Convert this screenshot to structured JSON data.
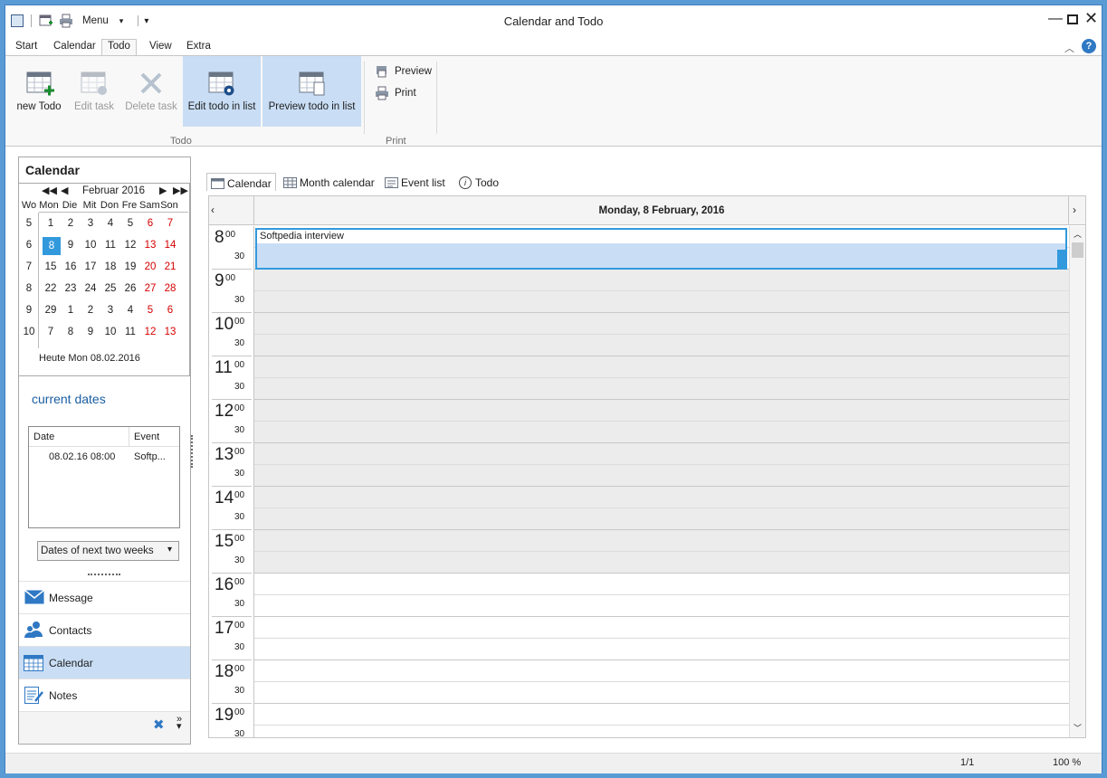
{
  "window": {
    "title": "Calendar and Todo"
  },
  "qat": {
    "menu_label": "Menu"
  },
  "ribbon_tabs": [
    "Start",
    "Calendar",
    "Todo",
    "View",
    "Extra"
  ],
  "ribbon": {
    "new_todo": "new Todo",
    "edit_task": "Edit task",
    "delete_task": "Delete task",
    "edit_todo_in_list": "Edit todo in list",
    "preview_todo_in_list": "Preview todo in list",
    "group_todo": "Todo",
    "preview": "Preview",
    "print": "Print",
    "group_print": "Print"
  },
  "sidebar": {
    "title": "Calendar",
    "mini_calendar": {
      "month_label": "Februar 2016",
      "headers": [
        "Wo",
        "Mon",
        "Die",
        "Mit",
        "Don",
        "Fre",
        "Sam",
        "Son"
      ],
      "weeks": [
        {
          "wk": "5",
          "days": [
            "1",
            "2",
            "3",
            "4",
            "5",
            "6",
            "7"
          ]
        },
        {
          "wk": "6",
          "days": [
            "8",
            "9",
            "10",
            "11",
            "12",
            "13",
            "14"
          ]
        },
        {
          "wk": "7",
          "days": [
            "15",
            "16",
            "17",
            "18",
            "19",
            "20",
            "21"
          ]
        },
        {
          "wk": "8",
          "days": [
            "22",
            "23",
            "24",
            "25",
            "26",
            "27",
            "28"
          ]
        },
        {
          "wk": "9",
          "days": [
            "29",
            "1",
            "2",
            "3",
            "4",
            "5",
            "6"
          ]
        },
        {
          "wk": "10",
          "days": [
            "7",
            "8",
            "9",
            "10",
            "11",
            "12",
            "13"
          ]
        }
      ],
      "today_label": "Heute Mon 08.02.2016",
      "selected_day": "8"
    },
    "current_dates": {
      "title": "current dates",
      "columns": [
        "Date",
        "Event"
      ],
      "rows": [
        {
          "date": "08.02.16 08:00",
          "event": "Softp..."
        }
      ],
      "range_select": "Dates of next two weeks"
    },
    "nav": [
      {
        "label": "Message",
        "icon": "envelope-icon"
      },
      {
        "label": "Contacts",
        "icon": "contacts-icon"
      },
      {
        "label": "Calendar",
        "icon": "calendar-icon"
      },
      {
        "label": "Notes",
        "icon": "notes-icon"
      }
    ]
  },
  "view_tabs": [
    "Calendar",
    "Month calendar",
    "Event list",
    "Todo"
  ],
  "day_view": {
    "date_header": "Monday, 8 February, 2016",
    "hours": [
      "8",
      "9",
      "10",
      "11",
      "12",
      "13",
      "14",
      "15",
      "16",
      "17",
      "18",
      "19"
    ],
    "minute_00": "00",
    "minute_30": "30",
    "appointment": {
      "title": "Softpedia interview"
    }
  },
  "status": {
    "page": "1/1",
    "zoom": "100 %"
  },
  "colors": {
    "accent": "#3399dd",
    "selection": "#c9def5",
    "weekend": "#d40000"
  }
}
